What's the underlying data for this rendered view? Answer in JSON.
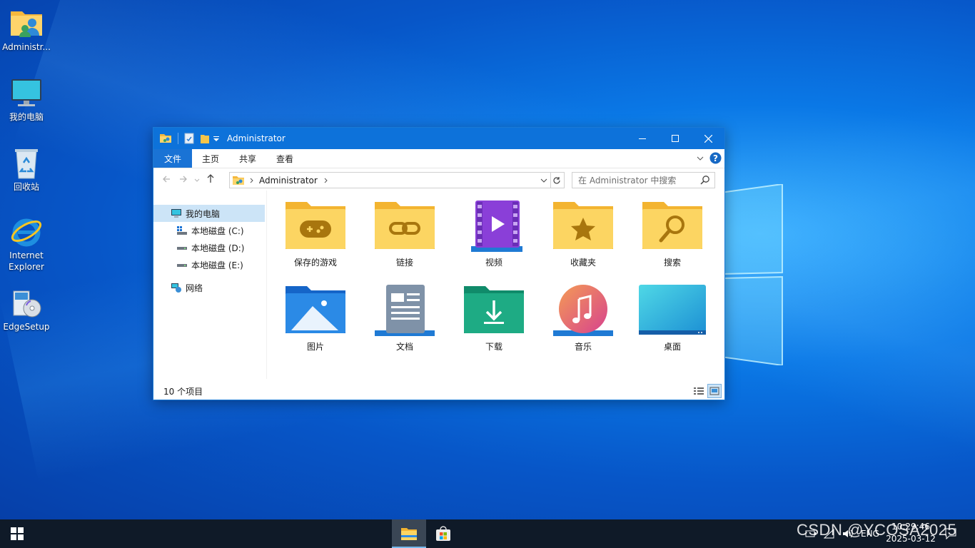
{
  "desktop": {
    "icons": [
      {
        "label": "Administr...",
        "icon": "user-folder-icon"
      },
      {
        "label": "我的电脑",
        "icon": "computer-icon"
      },
      {
        "label": "回收站",
        "icon": "recycle-bin-icon"
      },
      {
        "label": "Internet Explorer",
        "icon": "internet-explorer-icon"
      },
      {
        "label": "EdgeSetup",
        "icon": "installer-icon"
      }
    ]
  },
  "window": {
    "title": "Administrator",
    "ribbon_tabs": [
      "文件",
      "主页",
      "共享",
      "查看"
    ],
    "address": {
      "path": "Administrator"
    },
    "search": {
      "placeholder": "在 Administrator 中搜索"
    },
    "nav_pane": [
      {
        "label": "我的电脑",
        "icon": "computer-icon",
        "selected": true
      },
      {
        "label": "本地磁盘 (C:)",
        "icon": "windows-drive-icon"
      },
      {
        "label": "本地磁盘 (D:)",
        "icon": "drive-icon"
      },
      {
        "label": "本地磁盘 (E:)",
        "icon": "drive-icon"
      },
      {
        "label": "网络",
        "icon": "network-icon"
      }
    ],
    "items": [
      {
        "label": "保存的游戏",
        "icon": "saved-games-folder-icon"
      },
      {
        "label": "链接",
        "icon": "links-folder-icon"
      },
      {
        "label": "视频",
        "icon": "videos-folder-icon"
      },
      {
        "label": "收藏夹",
        "icon": "favorites-folder-icon"
      },
      {
        "label": "搜索",
        "icon": "searches-folder-icon"
      },
      {
        "label": "图片",
        "icon": "pictures-folder-icon"
      },
      {
        "label": "文档",
        "icon": "documents-folder-icon"
      },
      {
        "label": "下载",
        "icon": "downloads-folder-icon"
      },
      {
        "label": "音乐",
        "icon": "music-folder-icon"
      },
      {
        "label": "桌面",
        "icon": "desktop-folder-icon"
      }
    ],
    "status": {
      "count": "10 个项目"
    }
  },
  "taskbar": {
    "language": "ENG",
    "time": "10:29:46",
    "date": "2025-03-12"
  },
  "watermark": "CSDN @YCOSA2025",
  "colors": {
    "accent": "#0d72da",
    "taskbar": "#0f1a28",
    "selection": "#cce4f7"
  }
}
